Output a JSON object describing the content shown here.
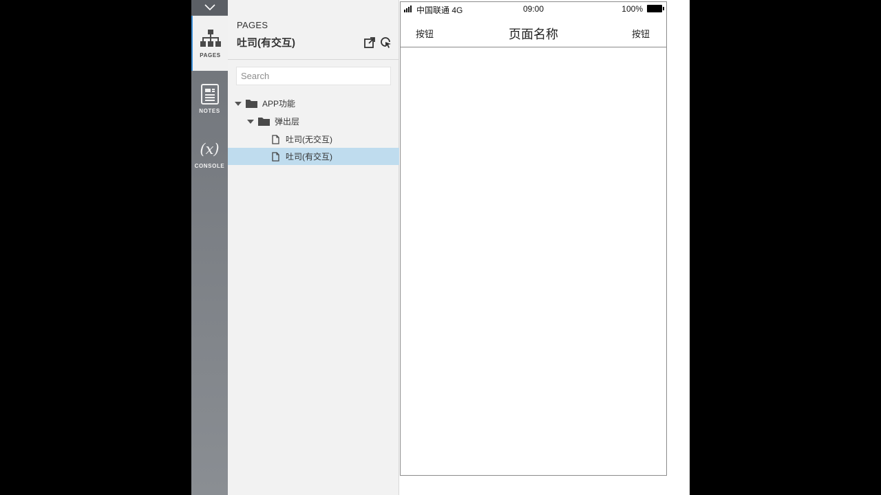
{
  "rail": {
    "items": [
      {
        "label": "PAGES",
        "icon": "sitemap-icon",
        "active": true
      },
      {
        "label": "NOTES",
        "icon": "notes-icon",
        "active": false
      },
      {
        "label": "CONSOLE",
        "icon": "variable-x-icon",
        "glyph": "(x)",
        "active": false
      }
    ]
  },
  "panel": {
    "heading": "PAGES",
    "title": "吐司(有交互)",
    "search": {
      "placeholder": "Search",
      "value": ""
    },
    "tree": [
      {
        "type": "folder",
        "label": "APP功能",
        "expanded": true
      },
      {
        "type": "folder",
        "label": "弹出层",
        "expanded": true
      },
      {
        "type": "page",
        "label": "吐司(无交互)",
        "selected": false
      },
      {
        "type": "page",
        "label": "吐司(有交互)",
        "selected": true
      }
    ]
  },
  "phone": {
    "status": {
      "carrier": "中国联通 4G",
      "time": "09:00",
      "battery": "100%"
    },
    "nav": {
      "left_button": "按钮",
      "title": "页面名称",
      "right_button": "按钮"
    }
  },
  "colors": {
    "rail_bg": "#7d8187",
    "panel_bg": "#f2f2f2",
    "selection": "#bfdcee",
    "accent": "#3d8fd6"
  }
}
